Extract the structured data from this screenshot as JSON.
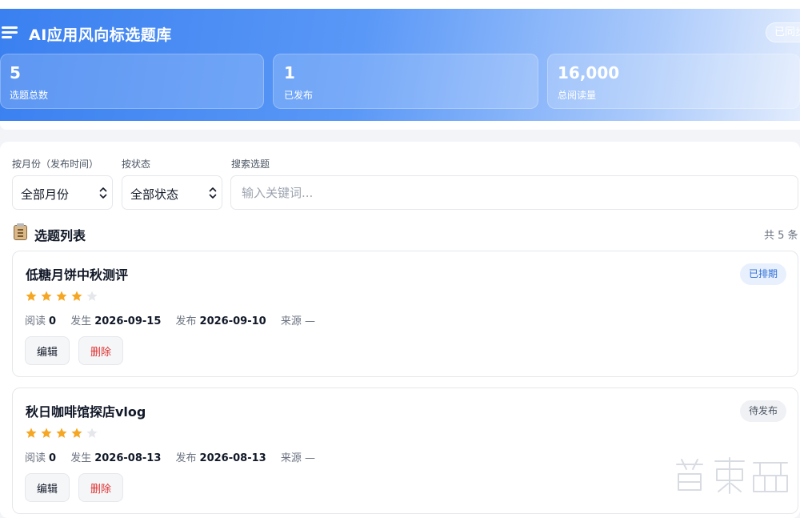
{
  "header": {
    "title": "AI应用风向标选题库",
    "sync_status": "已同步",
    "stats": [
      {
        "value": "5",
        "label": "选题总数"
      },
      {
        "value": "1",
        "label": "已发布"
      },
      {
        "value": "16,000",
        "label": "总阅读量"
      }
    ]
  },
  "filters": {
    "month_label": "按月份（发布时间）",
    "month_value": "全部月份",
    "status_label": "按状态",
    "status_value": "全部状态",
    "search_label": "搜索选题",
    "search_placeholder": "输入关键词..."
  },
  "list": {
    "title": "选题列表",
    "count": "共 5 条",
    "items": [
      {
        "title": "低糖月饼中秋测评",
        "status": "已排期",
        "rating": 4,
        "max_rating": 5,
        "read_label": "阅读",
        "read_value": "0",
        "occur_label": "发生",
        "occur_value": "2026-09-15",
        "publish_label": "发布",
        "publish_value": "2026-09-10",
        "source_label": "来源",
        "source_value": "—",
        "edit_label": "编辑",
        "delete_label": "删除"
      },
      {
        "title": "秋日咖啡馆探店vlog",
        "status": "待发布",
        "rating": 4,
        "max_rating": 5,
        "read_label": "阅读",
        "read_value": "0",
        "occur_label": "发生",
        "occur_value": "2026-08-13",
        "publish_label": "发布",
        "publish_value": "2026-08-13",
        "source_label": "来源",
        "source_value": "—",
        "edit_label": "编辑",
        "delete_label": "删除"
      }
    ]
  },
  "colors": {
    "accent": "#3a80f0",
    "star_filled": "#f5a623",
    "star_empty": "#e5e7eb",
    "delete_text": "#e03131",
    "badge_scheduled_bg": "#e8f0fe",
    "badge_scheduled_text": "#2f6fd6",
    "badge_pending_bg": "#f0f1f4",
    "badge_pending_text": "#4b5563"
  },
  "watermark": {
    "text": "智东西",
    "icon": "zhidx-watermark-logo"
  }
}
